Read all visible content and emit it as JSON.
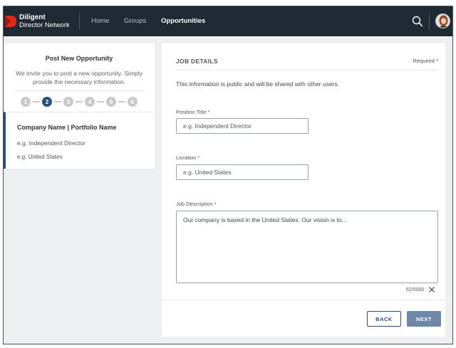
{
  "nav": {
    "brand_line1": "Diligent",
    "brand_line2": "Director Network",
    "items": [
      {
        "label": "Home"
      },
      {
        "label": "Groups"
      },
      {
        "label": "Opportunities"
      }
    ],
    "accent": "#e02a1c",
    "bg": "#1f2a35"
  },
  "left_panel": {
    "title": "Post New Opportunity",
    "description": "We invite you to post a new opportunity. Simply provide the necessary information.",
    "steps": [
      "1",
      "2",
      "3",
      "4",
      "5",
      "6"
    ],
    "current_step": 2,
    "summary_title": "Company Name | Portfolio Name",
    "summary_line1": "e.g. Independent Director",
    "summary_line2": "e.g. United States"
  },
  "form": {
    "section_title": "JOB DETAILS",
    "required_note": "Required",
    "info": "This information is public and will be shared with other users.",
    "position_title_label": "Position Title",
    "position_title_placeholder": "e.g. Independent Director",
    "location_label": "Location",
    "location_placeholder": "e.g. United States",
    "job_description_label": "Job Description",
    "job_description_value": "Our company is based in the United States. Our vision is to...",
    "char_counter": "62/5000",
    "asterisk": "*"
  },
  "actions": {
    "back_label": "BACK",
    "next_label": "NEXT"
  }
}
